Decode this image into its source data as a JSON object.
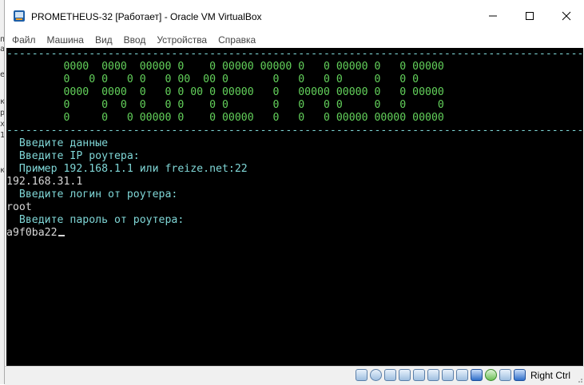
{
  "window": {
    "title": "PROMETHEUS-32 [Работает] - Oracle VM VirtualBox"
  },
  "menu": [
    "Файл",
    "Машина",
    "Вид",
    "Ввод",
    "Устройства",
    "Справка"
  ],
  "console": {
    "rule": "------------------------------------------------------------------------------------------------------",
    "banner": [
      "         0000  0000  00000 0    0 00000 00000 0   0 00000 0   0 00000",
      "         0   0 0   0 0   0 00  00 0       0   0   0 0     0   0 0",
      "         0000  0000  0   0 0 00 0 00000   0   00000 00000 0   0 00000",
      "         0     0  0  0   0 0    0 0       0   0   0 0     0   0     0",
      "         0     0   0 00000 0    0 00000   0   0   0 00000 00000 00000"
    ],
    "prompt_data": "  Введите данные",
    "prompt_ip": "  Введите IP роутера:",
    "prompt_example": "  Пример 192.168.1.1 или freize.net:22",
    "input_ip": "192.168.31.1",
    "prompt_login": "  Введите логин от роутера:",
    "input_login": "root",
    "prompt_password": "  Введите пароль от роутера:",
    "input_password": "a9f0ba22"
  },
  "statusbar": {
    "host_key": "Right Ctrl",
    "icons": [
      "hard-disk-icon",
      "optical-drive-icon",
      "audio-icon",
      "network-icon",
      "usb-icon",
      "shared-folders-icon",
      "display-icon",
      "video-capture-icon",
      "recording-icon",
      "vm-state-icon",
      "mouse-integration-icon",
      "keyboard-capture-icon"
    ]
  },
  "colors": {
    "banner": "#63d15b",
    "prompt": "#7fd6d6",
    "input": "#d7d7d7",
    "console_bg": "#000000"
  }
}
